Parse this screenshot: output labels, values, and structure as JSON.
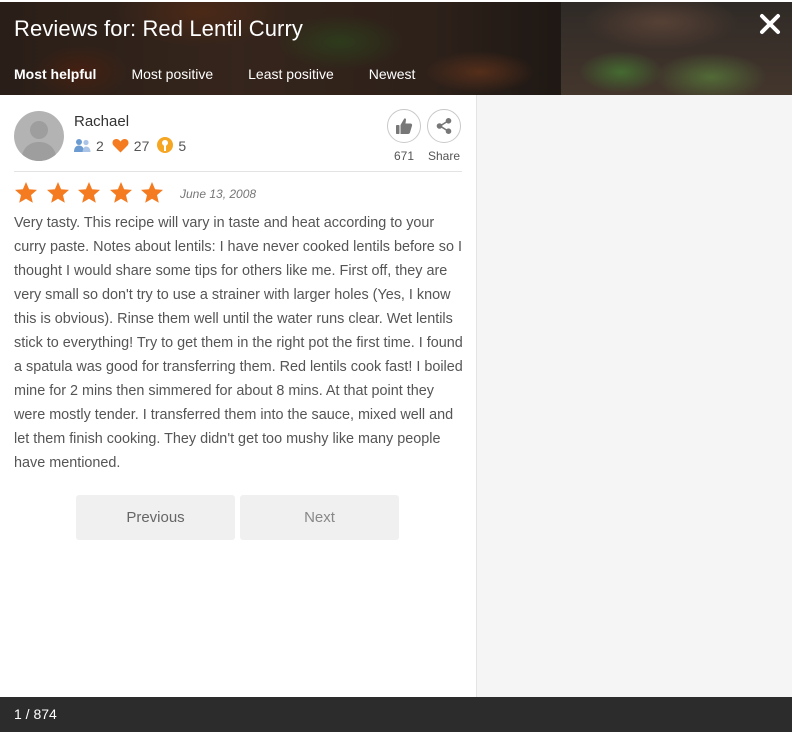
{
  "header": {
    "title": "Reviews for: Red Lentil Curry",
    "close_icon": "close-x-icon",
    "tabs": [
      {
        "label": "Most helpful",
        "active": true
      },
      {
        "label": "Most positive",
        "active": false
      },
      {
        "label": "Least positive",
        "active": false
      },
      {
        "label": "Newest",
        "active": false
      }
    ]
  },
  "review": {
    "reviewer_name": "Rachael",
    "stats": {
      "followers": "2",
      "favorites": "27",
      "made_it": "5"
    },
    "likes_count": "671",
    "share_label": "Share",
    "rating": 5,
    "rating_max": 5,
    "date": "June 13, 2008",
    "text": "Very tasty. This recipe will vary in taste and heat according to your curry paste. Notes about lentils: I have never cooked lentils before so I thought I would share some tips for others like me. First off, they are very small so don't try to use a strainer with larger holes (Yes, I know this is obvious). Rinse them well until the water runs clear. Wet lentils stick to everything! Try to get them in the right pot the first time. I found a spatula was good for transferring them. Red lentils cook fast! I boiled mine for 2 mins then simmered for about 8 mins. At that point they were mostly tender. I transferred them into the sauce, mixed well and let them finish cooking. They didn't get too mushy like many people have mentioned."
  },
  "pagination": {
    "previous_label": "Previous",
    "next_label": "Next",
    "page_indicator": "1 / 874"
  },
  "colors": {
    "star": "#f47b20",
    "favorites_heart": "#f47b20",
    "made_it_badge": "#f5a623",
    "followers_icon": "#6b9bd1",
    "footer_bg": "#2c2c2c",
    "side_panel_bg": "#f5f5f5"
  }
}
